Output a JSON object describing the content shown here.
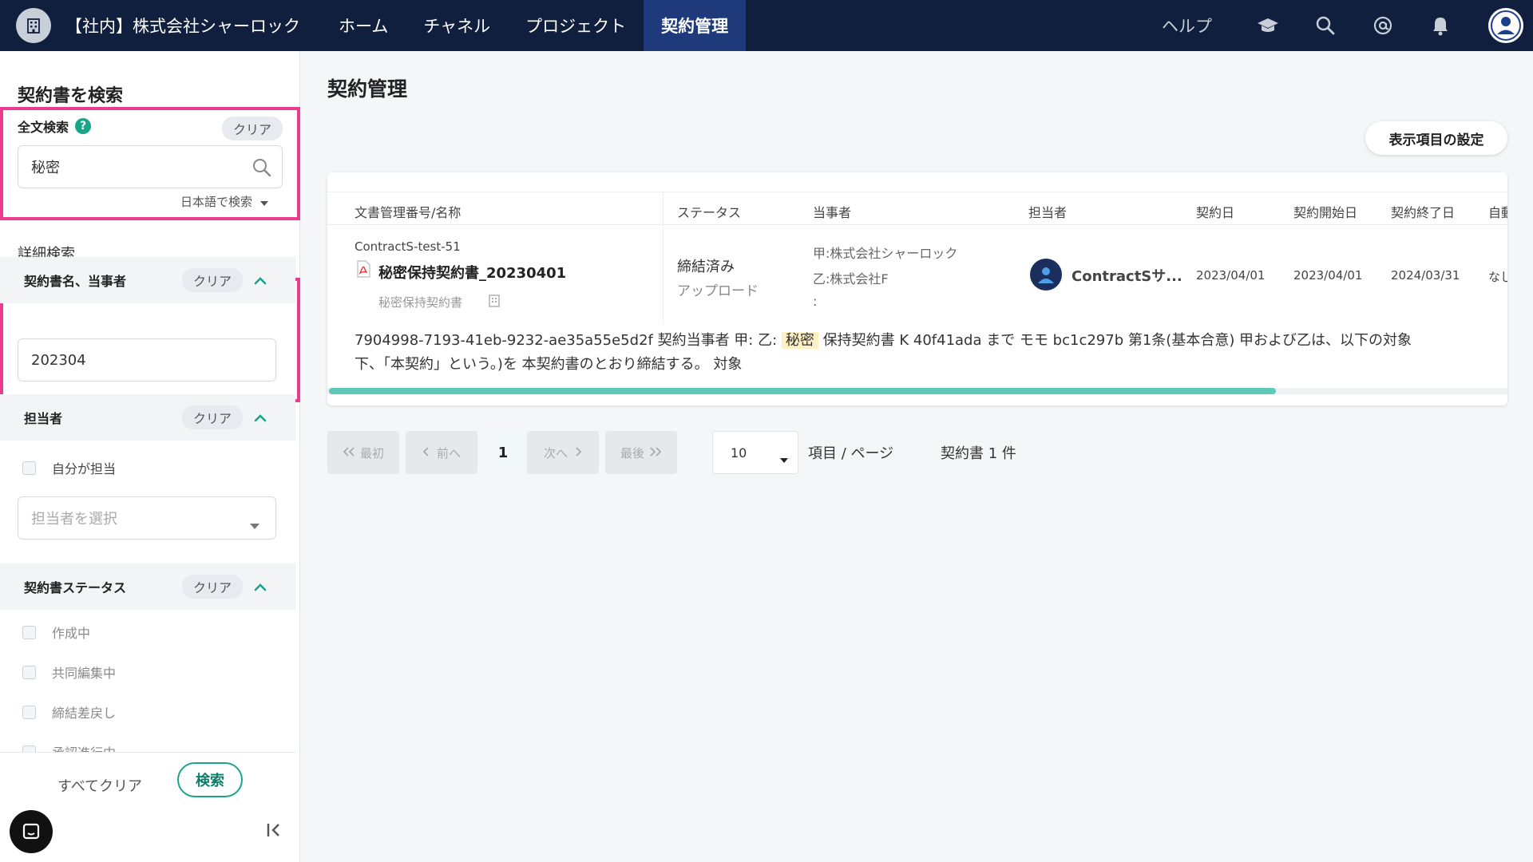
{
  "header": {
    "org_name": "【社内】株式会社シャーロック",
    "nav": [
      "ホーム",
      "チャネル",
      "プロジェクト",
      "契約管理"
    ],
    "help": "ヘルプ"
  },
  "sidebar": {
    "title": "契約書を検索",
    "fulltext": {
      "label": "全文検索",
      "clear": "クリア",
      "value": "秘密",
      "lang": "日本語で検索"
    },
    "advanced_label": "詳細検索",
    "name_party": {
      "label": "契約書名、当事者",
      "clear": "クリア",
      "value": "202304"
    },
    "assignee": {
      "label": "担当者",
      "clear": "クリア",
      "self": "自分が担当",
      "placeholder": "担当者を選択"
    },
    "status": {
      "label": "契約書ステータス",
      "clear": "クリア",
      "options": [
        "作成中",
        "共同編集中",
        "締結差戻し",
        "承認進行中"
      ]
    },
    "footer": {
      "clear_all": "すべてクリア",
      "search": "検索"
    }
  },
  "main": {
    "title": "契約管理",
    "settings_button": "表示項目の設定",
    "columns": [
      "文書管理番号/名称",
      "ステータス",
      "当事者",
      "担当者",
      "契約日",
      "契約開始日",
      "契約終了日",
      "自動"
    ],
    "row": {
      "doc_id": "ContractS-test-51",
      "doc_name": "秘密保持契約書_20230401",
      "doc_type": "秘密保持契約書",
      "status": "締結済み",
      "status_sub": "アップロード",
      "party_a": "甲:株式会社シャーロック",
      "party_b": "乙:株式会社F",
      "party_c": ":",
      "assignee": "ContractSサ...",
      "contract_date": "2023/04/01",
      "start_date": "2023/04/01",
      "end_date": "2024/03/31",
      "auto_renew": "なし"
    },
    "snippet": {
      "before": "7904998-7193-41eb-9232-ae35a55e5d2f 契約当事者 甲: 乙:",
      "highlight": "秘密",
      "after": "保持契約書 K 40f41ada まで モモ bc1c297b 第1条(基本合意) 甲および乙は、以下の対象",
      "line2": "下、「本契約」という。)を 本契約書のとおり締結する。 対象"
    },
    "pagination": {
      "first": "最初",
      "prev": "前へ",
      "current": "1",
      "next": "次へ",
      "last": "最後",
      "per_page": "10",
      "per_page_label": "項目 / ページ",
      "count": "契約書 1 件"
    }
  }
}
